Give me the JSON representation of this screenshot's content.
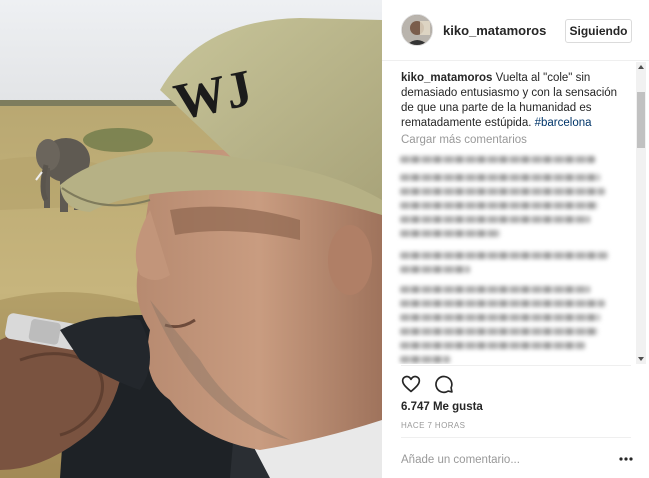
{
  "post": {
    "username": "kiko_matamoros",
    "follow_label": "Siguiendo",
    "avatar_icon": "user-avatar",
    "caption": {
      "user": "kiko_matamoros",
      "text": " Vuelta al \"cole\" sin demasiado entusiasmo y con la sensación de que una parte de la humanidad es rematadamente estúpida. ",
      "hashtag": "#barcelona"
    },
    "load_more_label": "Cargar más comentarios",
    "likes": "6.747 Me gusta",
    "time_ago": "HACE 7 HORAS",
    "add_comment_placeholder": "Añade un comentario...",
    "icons": {
      "like": "heart-icon",
      "comment": "comment-bubble-icon",
      "more": "more-options-icon"
    }
  },
  "colors": {
    "text": "#262626",
    "muted": "#999999",
    "hashtag": "#003569",
    "border": "#dbdbdb"
  }
}
